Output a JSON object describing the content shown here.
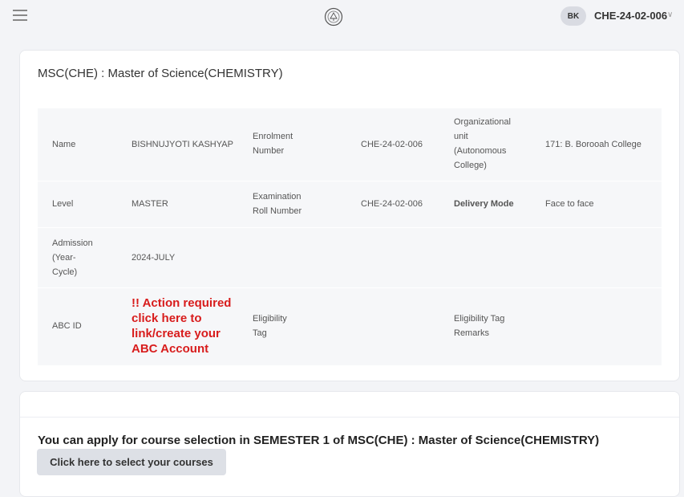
{
  "header": {
    "avatar_initials": "BK",
    "username": "CHE-24-02-006"
  },
  "program": {
    "title": "MSC(CHE) : Master of Science(CHEMISTRY)"
  },
  "details": {
    "name_label": "Name",
    "name_value": "BISHNUJYOTI KASHYAP",
    "enrolment_label": "Enrolment Number",
    "enrolment_value": "CHE-24-02-006",
    "org_unit_label": "Organizational unit (Autonomous College)",
    "org_unit_value": "171: B. Borooah College",
    "level_label": "Level",
    "level_value": "MASTER",
    "exam_roll_label": "Examination Roll Number",
    "exam_roll_value": "CHE-24-02-006",
    "delivery_label": "Delivery Mode",
    "delivery_value": "Face to face",
    "admission_label": "Admission (Year-Cycle)",
    "admission_value": "2024-JULY",
    "abc_label": "ABC ID",
    "abc_action": "!! Action required click here to link/create your ABC Account",
    "eligibility_tag_label": "Eligibility Tag",
    "eligibility_remarks_label": "Eligibility Tag Remarks"
  },
  "course_selection": {
    "message": "You can apply for course selection in SEMESTER 1 of MSC(CHE) : Master of Science(CHEMISTRY)",
    "button_label": "Click here to select your courses"
  },
  "colors": {
    "background": "#f3f4f7",
    "alert_red": "#d81c1c",
    "button_gray": "#dde0e6"
  },
  "icons": [
    "menu-icon",
    "university-logo-icon",
    "chevron-down-icon"
  ]
}
